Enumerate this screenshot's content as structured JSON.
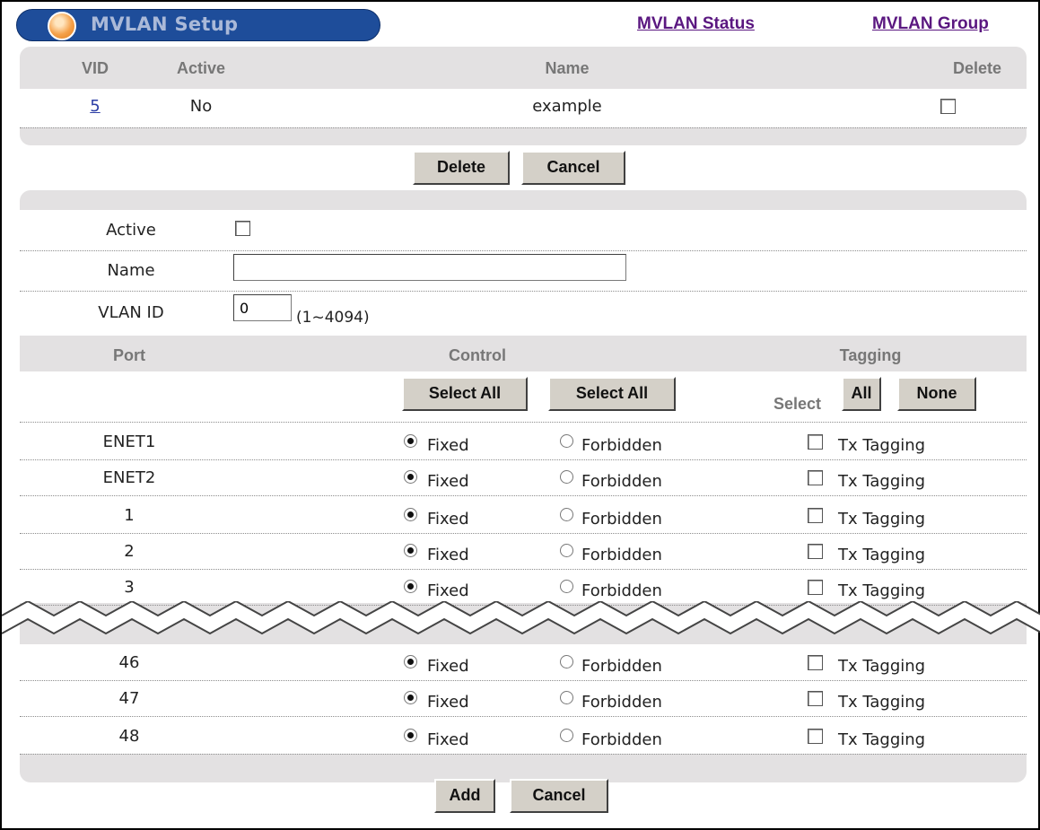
{
  "header": {
    "title": "MVLAN Setup",
    "links": [
      "MVLAN Status",
      "MVLAN Group"
    ]
  },
  "summary_table": {
    "columns": [
      "VID",
      "Active",
      "Name",
      "Delete"
    ],
    "rows": [
      {
        "vid": "5",
        "active": "No",
        "name": "example",
        "delete_checked": false
      }
    ]
  },
  "summary_buttons": {
    "delete": "Delete",
    "cancel": "Cancel"
  },
  "form": {
    "active_label": "Active",
    "name_label": "Name",
    "name_value": "",
    "vlan_id_label": "VLAN ID",
    "vlan_id_value": "0",
    "vlan_id_range": "(1~4094)"
  },
  "port_table": {
    "columns": [
      "Port",
      "Control",
      "Tagging"
    ],
    "control_select_all_1": "Select All",
    "control_select_all_2": "Select All",
    "tagging_select_label": "Select",
    "tagging_all": "All",
    "tagging_none": "None",
    "fixed_label": "Fixed",
    "forbidden_label": "Forbidden",
    "tx_label": "Tx Tagging",
    "rows_top": [
      {
        "port": "ENET1",
        "control": "fixed",
        "tx": false
      },
      {
        "port": "ENET2",
        "control": "fixed",
        "tx": false
      },
      {
        "port": "1",
        "control": "fixed",
        "tx": false
      },
      {
        "port": "2",
        "control": "fixed",
        "tx": false
      },
      {
        "port": "3",
        "control": "fixed",
        "tx": false
      }
    ],
    "rows_bottom": [
      {
        "port": "46",
        "control": "fixed",
        "tx": false
      },
      {
        "port": "47",
        "control": "fixed",
        "tx": false
      },
      {
        "port": "48",
        "control": "fixed",
        "tx": false
      }
    ]
  },
  "bottom_buttons": {
    "add": "Add",
    "cancel": "Cancel"
  }
}
